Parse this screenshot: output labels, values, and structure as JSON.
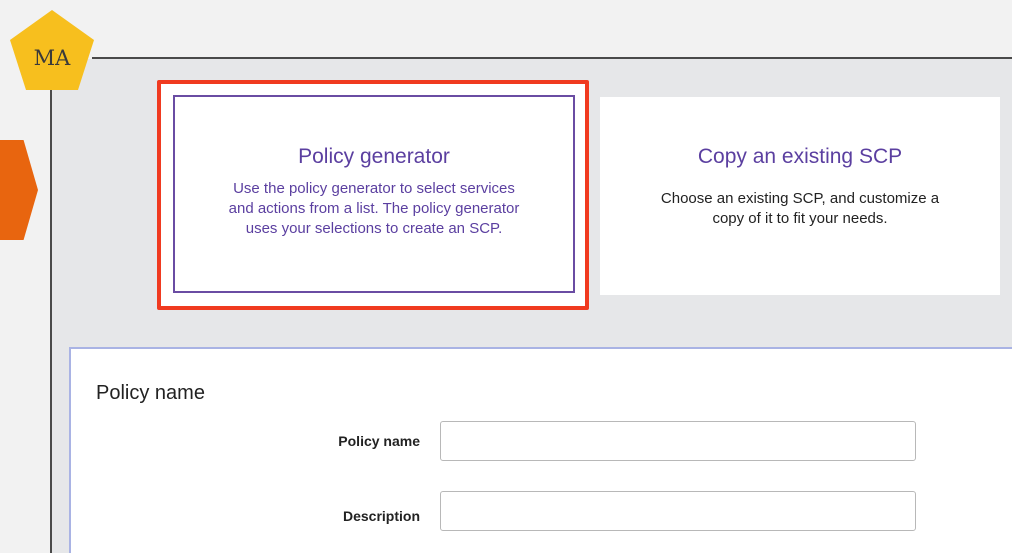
{
  "badge": {
    "label": "MA"
  },
  "options": {
    "policy_generator": {
      "title": "Policy generator",
      "description_lines": [
        "Use the policy generator to select services",
        "and actions from a list. The policy generator",
        "uses your selections to create an SCP."
      ]
    },
    "copy_existing": {
      "title": "Copy an existing SCP",
      "description_lines": [
        "Choose an existing SCP, and customize a",
        "copy of it to fit your needs."
      ]
    }
  },
  "form": {
    "section_title": "Policy name",
    "policy_name": {
      "label": "Policy name",
      "value": "",
      "placeholder": ""
    },
    "description": {
      "label": "Description",
      "value": "",
      "placeholder": ""
    }
  },
  "colors": {
    "accent_purple": "#5b3fa0",
    "highlight_red": "#f03a20",
    "arrow_orange": "#e8650f",
    "badge_yellow": "#f7bf1e"
  },
  "icons": [
    "pentagon-badge-icon",
    "orange-arrow-icon"
  ]
}
